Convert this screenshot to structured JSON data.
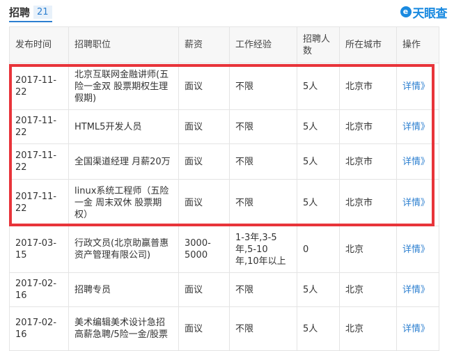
{
  "header": {
    "title": "招聘",
    "count": "21",
    "logo_text": "天眼查",
    "logo_mark": "e",
    "accent_color": "#2c7fd0",
    "logo_color": "#1a8ae0"
  },
  "table": {
    "columns": [
      "发布时间",
      "招聘职位",
      "薪资",
      "工作经验",
      "招聘人数",
      "所在城市",
      "操作"
    ],
    "rows": [
      {
        "date": "2017-11-22",
        "position": "北京互联网金融讲师(五险一金双 股票期权生理假期)",
        "salary": "面议",
        "experience": "不限",
        "headcount": "5人",
        "city": "北京市",
        "action": "详情》"
      },
      {
        "date": "2017-11-22",
        "position": "HTML5开发人员",
        "salary": "面议",
        "experience": "不限",
        "headcount": "5人",
        "city": "北京市",
        "action": "详情》"
      },
      {
        "date": "2017-11-22",
        "position": "全国渠道经理 月薪20万",
        "salary": "面议",
        "experience": "不限",
        "headcount": "5人",
        "city": "北京市",
        "action": "详情》"
      },
      {
        "date": "2017-11-22",
        "position": "linux系统工程师（五险一金 周末双休 股票期权）",
        "salary": "面议",
        "experience": "不限",
        "headcount": "5人",
        "city": "北京市",
        "action": "详情》"
      },
      {
        "date": "2017-03-15",
        "position": "行政文员(北京助赢普惠资产管理有限公司)",
        "salary": "3000-5000",
        "experience": "1-3年,3-5年,5-10年,10年以上",
        "headcount": "0",
        "city": "北京",
        "action": "详情》"
      },
      {
        "date": "2017-02-16",
        "position": "招聘专员",
        "salary": "面议",
        "experience": "不限",
        "headcount": "5人",
        "city": "北京",
        "action": "详情》"
      },
      {
        "date": "2017-02-16",
        "position": "美术编辑美术设计急招高薪急聘/5险一金/股票",
        "salary": "面议",
        "experience": "不限",
        "headcount": "5人",
        "city": "北京",
        "action": "详情》"
      }
    ]
  },
  "highlight": {
    "color": "#e8343a"
  }
}
